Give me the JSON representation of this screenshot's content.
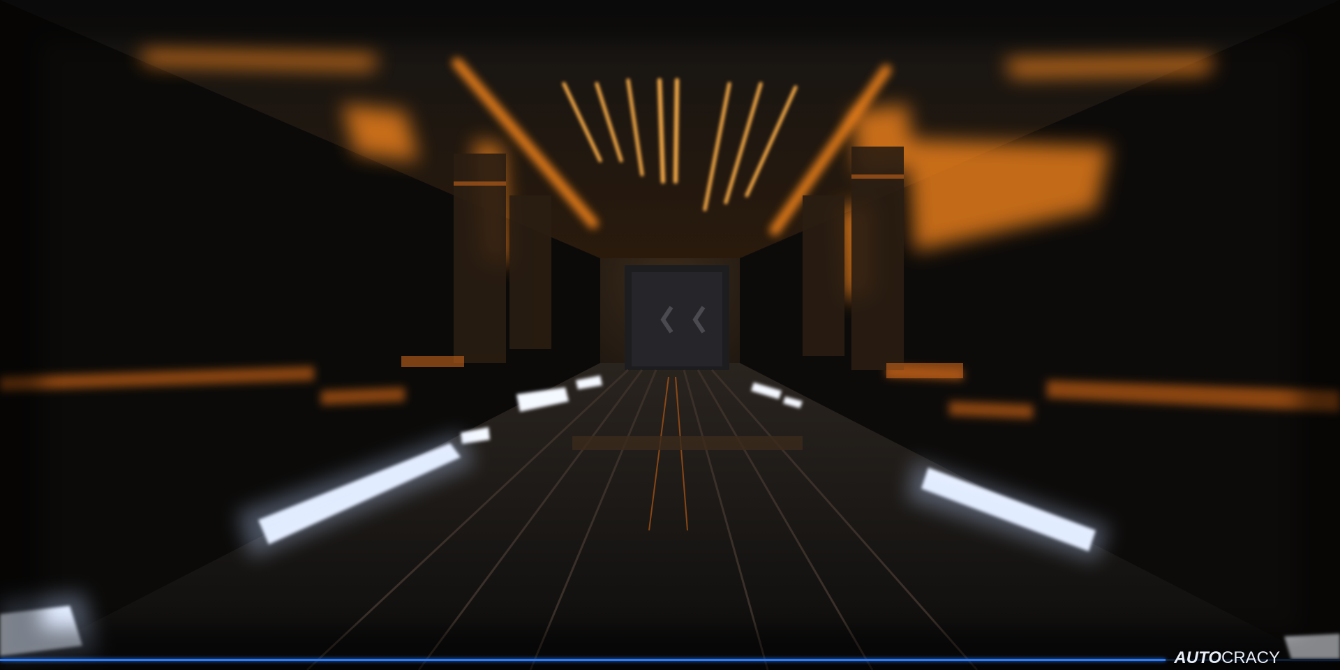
{
  "game": {
    "logo_bold": "AUTO",
    "logo_light": "CRACY"
  },
  "loading_progress": 0.87,
  "colors": {
    "accent": "#2e7cf6",
    "corridor_glow": "#ff8a1e",
    "floor_light": "#eef4ff"
  }
}
